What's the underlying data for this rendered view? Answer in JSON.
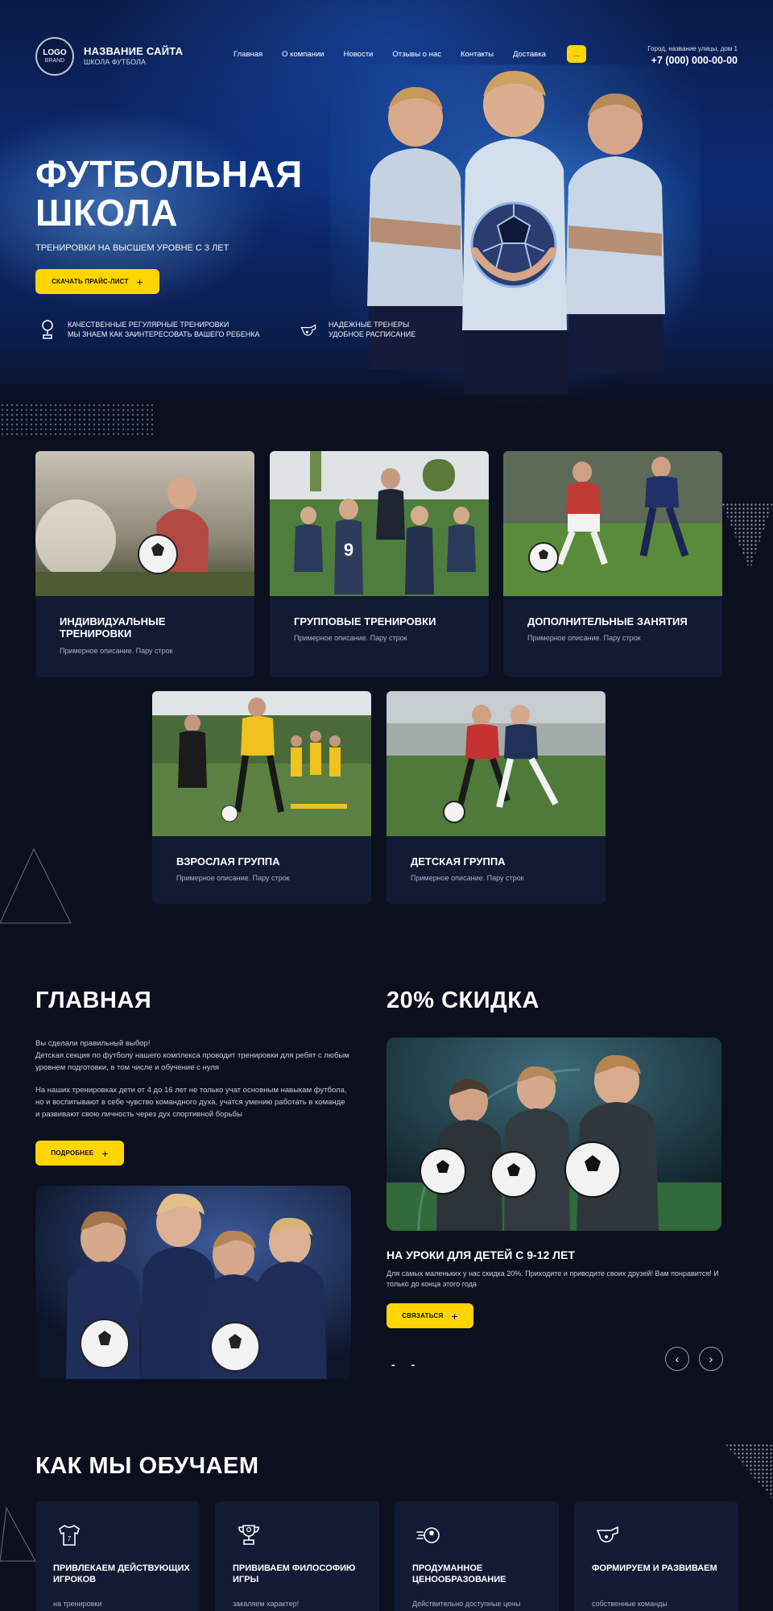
{
  "header": {
    "logo_line1": "LOGO",
    "logo_line2": "BRAND",
    "site_name": "НАЗВАНИЕ САЙТА",
    "site_subtitle": "ШКОЛА ФУТБОЛА",
    "nav": [
      "Главная",
      "О компании",
      "Новости",
      "Отзывы о нас",
      "Контакты",
      "Доставка"
    ],
    "more_button": "...",
    "address": "Город, название улицы, дом 1",
    "phone": "+7 (000) 000-00-00"
  },
  "hero": {
    "title_line1": "ФУТБОЛЬНАЯ",
    "title_line2": "ШКОЛА",
    "subtitle": "ТРЕНИРОВКИ НА ВЫСШЕМ УРОВНЕ С 3 ЛЕТ",
    "cta": "СКАЧАТЬ ПРАЙС-ЛИСТ",
    "features": [
      {
        "icon": "trophy-icon",
        "line1": "КАЧЕСТВЕННЫЕ РЕГУЛЯРНЫЕ ТРЕНИРОВКИ",
        "line2": "МЫ ЗНАЕМ КАК ЗАИНТЕРЕСОВАТЬ ВАШЕГО РЕБЕНКА"
      },
      {
        "icon": "whistle-icon",
        "line1": "НАДЕЖНЫЕ ТРЕНЕРЫ",
        "line2": "УДОБНОЕ РАСПИСАНИЕ"
      }
    ]
  },
  "services": [
    {
      "title": "ИНДИВИДУАЛЬНЫЕ ТРЕНИРОВКИ",
      "desc": "Примерное описание. Пару строк"
    },
    {
      "title": "ГРУППОВЫЕ ТРЕНИРОВКИ",
      "desc": "Примерное описание. Пару строк"
    },
    {
      "title": "ДОПОЛНИТЕЛЬНЫЕ ЗАНЯТИЯ",
      "desc": "Примерное описание. Пару строк"
    },
    {
      "title": "ВЗРОСЛАЯ ГРУППА",
      "desc": "Примерное описание. Пару строк"
    },
    {
      "title": "ДЕТСКАЯ ГРУППА",
      "desc": "Примерное описание. Пару строк"
    }
  ],
  "main": {
    "heading": "ГЛАВНАЯ",
    "p1_line1": "Вы сделали правильный выбор!",
    "p1_line2": "Детская секция по футболу нашего комплекса проводит тренировки для ребят с любым уровнем подготовки, в том числе и обучение с нуля",
    "p2": "На наших тренировках дети от 4 до 16 лет не только учат основным навыкам футбола, но и воспитывают в себе чувство командного духа, учатся умению работать в команде и развивают свою личность через дух спортивной борьбы",
    "button": "ПОДРОБНЕЕ"
  },
  "discount": {
    "heading": "20% СКИДКА",
    "title": "НА УРОКИ ДЛЯ ДЕТЕЙ С 9-12 ЛЕТ",
    "text": "Для самых маленьких у нас скидка 20%. Приходите и приводите своих друзей! Вам понравится! И только до конца этого года",
    "button": "СВЯЗАТЬСЯ",
    "pager": "- -",
    "prev": "‹",
    "next": "›"
  },
  "teach": {
    "heading": "КАК МЫ ОБУЧАЕМ",
    "items": [
      {
        "icon": "jersey-icon",
        "title": "ПРИВЛЕКАЕМ ДЕЙСТВУЮЩИХ ИГРОКОВ",
        "desc": "на тренировки"
      },
      {
        "icon": "trophy-icon",
        "title": "ПРИВИВАЕМ ФИЛОСОФИЮ ИГРЫ",
        "desc": "закаляем характер!"
      },
      {
        "icon": "ball-icon",
        "title": "ПРОДУМАННОЕ ЦЕНООБРАЗОВАНИЕ",
        "desc": "Действительно доступные цены"
      },
      {
        "icon": "whistle-icon",
        "title": "ФОРМИРУЕМ И РАЗВИВАЕМ",
        "desc": "собственные команды"
      }
    ]
  },
  "colors": {
    "background": "#0b0f1e",
    "card": "#131a33",
    "accent": "#ffd500"
  }
}
